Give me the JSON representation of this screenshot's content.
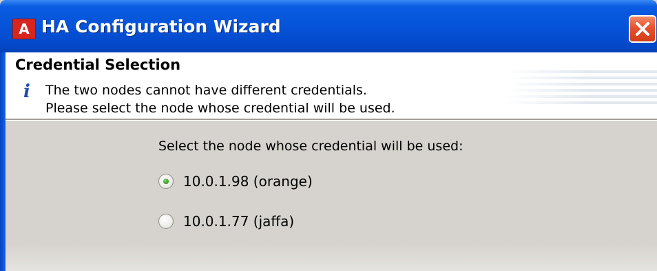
{
  "window": {
    "title": "HA Configuration Wizard",
    "app_logo_glyph": "A",
    "close_icon": "close-icon"
  },
  "header": {
    "section_title": "Credential Selection",
    "info_icon": "info-icon",
    "info_glyph": "i",
    "description_line1": "The two nodes cannot have different credentials.",
    "description_line2": "Please select the node whose credential will be used."
  },
  "body": {
    "prompt": "Select the node whose credential will be used:",
    "options": [
      {
        "label": "10.0.1.98 (orange)",
        "selected": true
      },
      {
        "label": "10.0.1.77 (jaffa)",
        "selected": false
      }
    ]
  },
  "colors": {
    "titlebar": "#0553d8",
    "close_button": "#e6522e",
    "dialog_body": "#d6d3ce",
    "logo": "#d7261e",
    "radio_selected_dot": "#2f9a1c"
  }
}
